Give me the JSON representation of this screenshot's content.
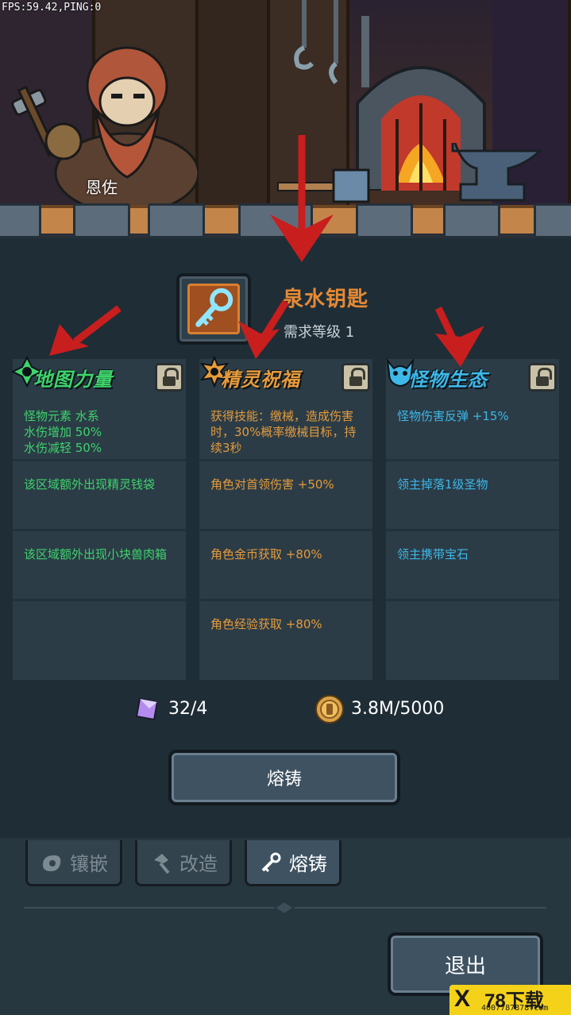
{
  "debug": {
    "fps_text": "FPS:59.42,PING:0"
  },
  "npc": {
    "name": "恩佐"
  },
  "item": {
    "name": "泉水钥匙",
    "requirement": "需求等级 1"
  },
  "columns": [
    {
      "title": "地图力量",
      "color": "#3ed36b",
      "entries": [
        "怪物元素 水系\n水伤增加 50%\n水伤减轻 50%",
        "该区域额外出现精灵钱袋",
        "该区域额外出现小块兽肉箱",
        ""
      ]
    },
    {
      "title": "精灵祝福",
      "color": "#e69a3a",
      "entries": [
        "获得技能：缴械，造成伤害时，30%概率缴械目标，持续3秒",
        "角色对首领伤害 +50%",
        "角色金币获取 +80%",
        "角色经验获取 +80%"
      ]
    },
    {
      "title": "怪物生态",
      "color": "#3db8e8",
      "entries": [
        "怪物伤害反弹 +15%",
        "领主掉落1级圣物",
        "领主携带宝石",
        ""
      ]
    }
  ],
  "resources": {
    "gem_count": "32/4",
    "coin_count": "3.8M/5000"
  },
  "forge_button": {
    "label": "熔铸"
  },
  "tabs": [
    {
      "label": "镶嵌",
      "icon": "stone-icon",
      "active": false
    },
    {
      "label": "改造",
      "icon": "hammer-icon",
      "active": false
    },
    {
      "label": "熔铸",
      "icon": "key-forge-icon",
      "active": true
    }
  ],
  "exit_button": {
    "label": "退出"
  },
  "watermark": {
    "brand": "78下载",
    "url": "4007787878.com"
  }
}
